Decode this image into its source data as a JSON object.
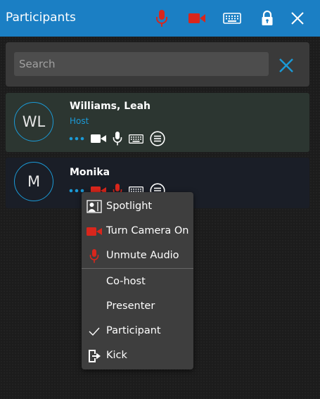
{
  "header": {
    "title": "Participants",
    "icons": [
      "mic-muted-icon",
      "camera-off-icon",
      "keyboard-icon",
      "lock-icon",
      "close-icon"
    ]
  },
  "search": {
    "placeholder": "Search",
    "value": ""
  },
  "participants": [
    {
      "initials": "WL",
      "name": "Williams, Leah",
      "role": "Host"
    },
    {
      "initials": "M",
      "name": "Monika",
      "role": ""
    }
  ],
  "menu": {
    "items": [
      {
        "label": "Spotlight",
        "icon": "spotlight-icon"
      },
      {
        "label": "Turn Camera On",
        "icon": "camera-icon"
      },
      {
        "label": "Unmute Audio",
        "icon": "mic-icon"
      },
      {
        "label": "Co-host",
        "icon": ""
      },
      {
        "label": "Presenter",
        "icon": ""
      },
      {
        "label": "Participant",
        "icon": "check-icon",
        "checked": true
      },
      {
        "label": "Kick",
        "icon": "kick-icon"
      }
    ]
  },
  "colors": {
    "header_bg": "#1b7fc4",
    "accent": "#1b9ad6",
    "muted_red": "#d9261c",
    "host_row_bg": "#2c3631",
    "menu_bg": "#3e3e3e"
  }
}
